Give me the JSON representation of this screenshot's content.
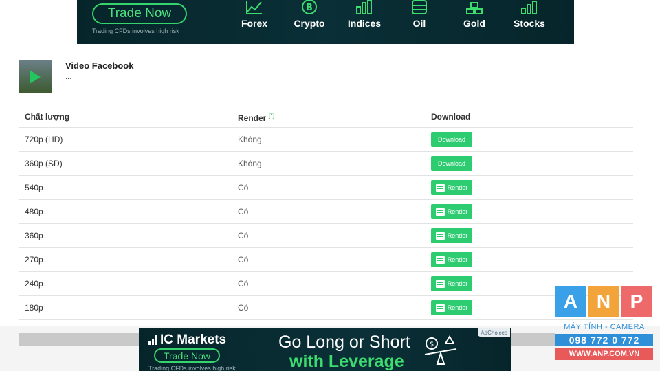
{
  "top_ad": {
    "trade_label": "Trade Now",
    "disclaimer": "Trading CFDs involves high risk",
    "categories": [
      "Forex",
      "Crypto",
      "Indices",
      "Oil",
      "Gold",
      "Stocks"
    ],
    "category_icons": [
      "line-chart-icon",
      "bitcoin-icon",
      "bar-chart-icon",
      "oil-barrel-icon",
      "gold-bars-icon",
      "stocks-icon"
    ]
  },
  "video": {
    "title": "Video Facebook",
    "description": "..."
  },
  "table": {
    "headers": {
      "quality": "Chất lượng",
      "render": "Render",
      "render_note": "[*]",
      "download": "Download"
    },
    "rows": [
      {
        "quality": "720p (HD)",
        "render": "Không",
        "action": "Download",
        "type": "download"
      },
      {
        "quality": "360p (SD)",
        "render": "Không",
        "action": "Download",
        "type": "download"
      },
      {
        "quality": "540p",
        "render": "Có",
        "action": "Render",
        "type": "render"
      },
      {
        "quality": "480p",
        "render": "Có",
        "action": "Render",
        "type": "render"
      },
      {
        "quality": "360p",
        "render": "Có",
        "action": "Render",
        "type": "render"
      },
      {
        "quality": "270p",
        "render": "Có",
        "action": "Render",
        "type": "render"
      },
      {
        "quality": "240p",
        "render": "Có",
        "action": "Render",
        "type": "render"
      },
      {
        "quality": "180p",
        "render": "Có",
        "action": "Render",
        "type": "render"
      }
    ]
  },
  "bottom_ad": {
    "brand": "IC Markets",
    "trade_label": "Trade Now",
    "disclaimer": "Trading CFDs involves high risk",
    "headline_1": "Go Long or Short",
    "headline_2": "with Leverage",
    "adchoices": "AdChoices"
  },
  "anp": {
    "letters": [
      "A",
      "N",
      "P"
    ],
    "tagline": "MÁY TÍNH - CAMERA",
    "phone": "098 772 0 772",
    "website": "WWW.ANP.COM.VN"
  },
  "colors": {
    "accent_green": "#2ecc71",
    "ad_background": "#06252b",
    "anp_blue": "#3aa0e8",
    "anp_orange": "#f2a43a",
    "anp_red": "#ee6a6a"
  }
}
